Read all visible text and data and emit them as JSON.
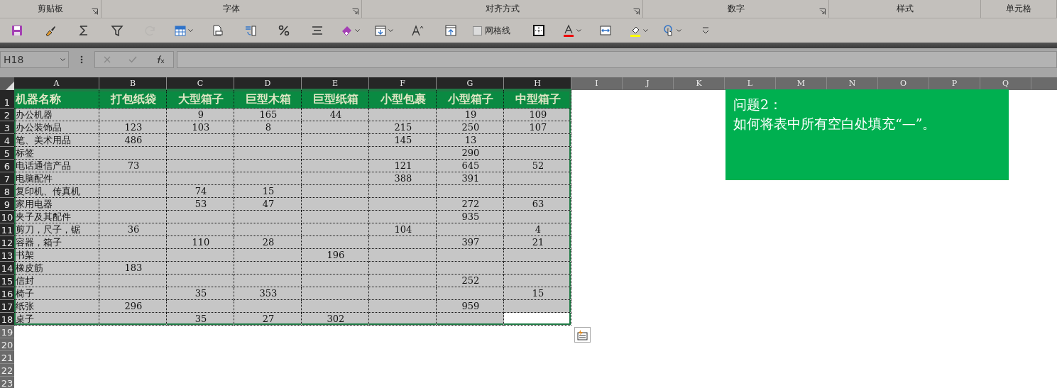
{
  "ribbon_groups": [
    {
      "label": "剪贴板",
      "launcher": true
    },
    {
      "label": "字体",
      "launcher": true
    },
    {
      "label": "对齐方式",
      "launcher": true
    },
    {
      "label": "数字",
      "launcher": true
    },
    {
      "label": "样式",
      "launcher": false
    },
    {
      "label": "单元格",
      "launcher": false
    }
  ],
  "toolbar": [
    {
      "kind": "save",
      "disabled": false,
      "dropdown": false
    },
    {
      "kind": "brush",
      "disabled": false,
      "dropdown": false
    },
    {
      "kind": "sum",
      "disabled": false,
      "dropdown": false
    },
    {
      "kind": "filter",
      "disabled": false,
      "dropdown": false
    },
    {
      "kind": "redo",
      "disabled": true,
      "dropdown": false
    },
    {
      "kind": "table",
      "disabled": false,
      "dropdown": true
    },
    {
      "kind": "print",
      "disabled": false,
      "dropdown": false
    },
    {
      "kind": "convert",
      "disabled": false,
      "dropdown": false
    },
    {
      "kind": "percent",
      "disabled": false,
      "dropdown": false
    },
    {
      "kind": "align",
      "disabled": false,
      "dropdown": false
    },
    {
      "kind": "eraser",
      "disabled": false,
      "dropdown": true
    },
    {
      "kind": "filldown",
      "disabled": false,
      "dropdown": true
    },
    {
      "kind": "fontsize",
      "disabled": false,
      "dropdown": false
    },
    {
      "kind": "upload",
      "disabled": false,
      "dropdown": false
    },
    {
      "kind": "checkbox",
      "label": "网格线",
      "checked": false
    },
    {
      "kind": "borders",
      "disabled": false,
      "dropdown": false
    },
    {
      "kind": "fontcolor",
      "disabled": false,
      "dropdown": true
    },
    {
      "kind": "merge",
      "disabled": false,
      "dropdown": false
    },
    {
      "kind": "fillcolor",
      "disabled": false,
      "dropdown": true
    },
    {
      "kind": "touch",
      "disabled": false,
      "dropdown": true
    },
    {
      "kind": "customize",
      "disabled": false,
      "dropdown": false
    }
  ],
  "name_box": "H18",
  "columns": [
    {
      "label": "A",
      "selected": true
    },
    {
      "label": "B",
      "selected": true
    },
    {
      "label": "C",
      "selected": true
    },
    {
      "label": "D",
      "selected": true
    },
    {
      "label": "E",
      "selected": true
    },
    {
      "label": "F",
      "selected": true
    },
    {
      "label": "G",
      "selected": true
    },
    {
      "label": "H",
      "selected": true
    },
    {
      "label": "I",
      "selected": false
    },
    {
      "label": "J",
      "selected": false
    },
    {
      "label": "K",
      "selected": false
    },
    {
      "label": "L",
      "selected": false
    },
    {
      "label": "M",
      "selected": false
    },
    {
      "label": "N",
      "selected": false
    },
    {
      "label": "O",
      "selected": false
    },
    {
      "label": "P",
      "selected": false
    },
    {
      "label": "Q",
      "selected": false
    }
  ],
  "rows": [
    {
      "number": "1",
      "selected": true,
      "header": true,
      "cells": [
        {
          "text": "机器名称",
          "active": false
        },
        {
          "text": "打包纸袋",
          "active": false
        },
        {
          "text": "大型箱子",
          "active": false
        },
        {
          "text": "巨型木箱",
          "active": false
        },
        {
          "text": "巨型纸箱",
          "active": false
        },
        {
          "text": "小型包裹",
          "active": false
        },
        {
          "text": "小型箱子",
          "active": false
        },
        {
          "text": "中型箱子",
          "active": false
        }
      ]
    },
    {
      "number": "2",
      "selected": true,
      "header": false,
      "cells": [
        {
          "text": "办公机器",
          "active": false
        },
        {
          "active": false
        },
        {
          "text": "9",
          "active": false
        },
        {
          "text": "165",
          "active": false
        },
        {
          "text": "44",
          "active": false
        },
        {
          "active": false
        },
        {
          "text": "19",
          "active": false
        },
        {
          "text": "109",
          "active": false
        }
      ]
    },
    {
      "number": "3",
      "selected": true,
      "header": false,
      "cells": [
        {
          "text": "办公装饰品",
          "active": false
        },
        {
          "text": "123",
          "active": false
        },
        {
          "text": "103",
          "active": false
        },
        {
          "text": "8",
          "active": false
        },
        {
          "active": false
        },
        {
          "text": "215",
          "active": false
        },
        {
          "text": "250",
          "active": false
        },
        {
          "text": "107",
          "active": false
        }
      ]
    },
    {
      "number": "4",
      "selected": true,
      "header": false,
      "cells": [
        {
          "text": "笔、美术用品",
          "active": false
        },
        {
          "text": "486",
          "active": false
        },
        {
          "active": false
        },
        {
          "active": false
        },
        {
          "active": false
        },
        {
          "text": "145",
          "active": false
        },
        {
          "text": "13",
          "active": false
        },
        {
          "active": false
        }
      ]
    },
    {
      "number": "5",
      "selected": true,
      "header": false,
      "cells": [
        {
          "text": "标签",
          "active": false
        },
        {
          "active": false
        },
        {
          "active": false
        },
        {
          "active": false
        },
        {
          "active": false
        },
        {
          "active": false
        },
        {
          "text": "290",
          "active": false
        },
        {
          "active": false
        }
      ]
    },
    {
      "number": "6",
      "selected": true,
      "header": false,
      "cells": [
        {
          "text": "电话通信产品",
          "active": false
        },
        {
          "text": "73",
          "active": false
        },
        {
          "active": false
        },
        {
          "active": false
        },
        {
          "active": false
        },
        {
          "text": "121",
          "active": false
        },
        {
          "text": "645",
          "active": false
        },
        {
          "text": "52",
          "active": false
        }
      ]
    },
    {
      "number": "7",
      "selected": true,
      "header": false,
      "cells": [
        {
          "text": "电脑配件",
          "active": false
        },
        {
          "active": false
        },
        {
          "active": false
        },
        {
          "active": false
        },
        {
          "active": false
        },
        {
          "text": "388",
          "active": false
        },
        {
          "text": "391",
          "active": false
        },
        {
          "active": false
        }
      ]
    },
    {
      "number": "8",
      "selected": true,
      "header": false,
      "cells": [
        {
          "text": "复印机、传真机",
          "active": false
        },
        {
          "active": false
        },
        {
          "text": "74",
          "active": false
        },
        {
          "text": "15",
          "active": false
        },
        {
          "active": false
        },
        {
          "active": false
        },
        {
          "active": false
        },
        {
          "active": false
        }
      ]
    },
    {
      "number": "9",
      "selected": true,
      "header": false,
      "cells": [
        {
          "text": "家用电器",
          "active": false
        },
        {
          "active": false
        },
        {
          "text": "53",
          "active": false
        },
        {
          "text": "47",
          "active": false
        },
        {
          "active": false
        },
        {
          "active": false
        },
        {
          "text": "272",
          "active": false
        },
        {
          "text": "63",
          "active": false
        }
      ]
    },
    {
      "number": "10",
      "selected": true,
      "header": false,
      "cells": [
        {
          "text": "夹子及其配件",
          "active": false
        },
        {
          "active": false
        },
        {
          "active": false
        },
        {
          "active": false
        },
        {
          "active": false
        },
        {
          "active": false
        },
        {
          "text": "935",
          "active": false
        },
        {
          "active": false
        }
      ]
    },
    {
      "number": "11",
      "selected": true,
      "header": false,
      "cells": [
        {
          "text": "剪刀，尺子，锯",
          "active": false
        },
        {
          "text": "36",
          "active": false
        },
        {
          "active": false
        },
        {
          "active": false
        },
        {
          "active": false
        },
        {
          "text": "104",
          "active": false
        },
        {
          "active": false
        },
        {
          "text": "4",
          "active": false
        }
      ]
    },
    {
      "number": "12",
      "selected": true,
      "header": false,
      "cells": [
        {
          "text": "容器，箱子",
          "active": false
        },
        {
          "active": false
        },
        {
          "text": "110",
          "active": false
        },
        {
          "text": "28",
          "active": false
        },
        {
          "active": false
        },
        {
          "active": false
        },
        {
          "text": "397",
          "active": false
        },
        {
          "text": "21",
          "active": false
        }
      ]
    },
    {
      "number": "13",
      "selected": true,
      "header": false,
      "cells": [
        {
          "text": "书架",
          "active": false
        },
        {
          "active": false
        },
        {
          "active": false
        },
        {
          "active": false
        },
        {
          "text": "196",
          "active": false
        },
        {
          "active": false
        },
        {
          "active": false
        },
        {
          "active": false
        }
      ]
    },
    {
      "number": "14",
      "selected": true,
      "header": false,
      "cells": [
        {
          "text": "橡皮筋",
          "active": false
        },
        {
          "text": "183",
          "active": false
        },
        {
          "active": false
        },
        {
          "active": false
        },
        {
          "active": false
        },
        {
          "active": false
        },
        {
          "active": false
        },
        {
          "active": false
        }
      ]
    },
    {
      "number": "15",
      "selected": true,
      "header": false,
      "cells": [
        {
          "text": "信封",
          "active": false
        },
        {
          "active": false
        },
        {
          "active": false
        },
        {
          "active": false
        },
        {
          "active": false
        },
        {
          "active": false
        },
        {
          "text": "252",
          "active": false
        },
        {
          "active": false
        }
      ]
    },
    {
      "number": "16",
      "selected": true,
      "header": false,
      "cells": [
        {
          "text": "椅子",
          "active": false
        },
        {
          "active": false
        },
        {
          "text": "35",
          "active": false
        },
        {
          "text": "353",
          "active": false
        },
        {
          "active": false
        },
        {
          "active": false
        },
        {
          "active": false
        },
        {
          "text": "15",
          "active": false
        }
      ]
    },
    {
      "number": "17",
      "selected": true,
      "header": false,
      "cells": [
        {
          "text": "纸张",
          "active": false
        },
        {
          "text": "296",
          "active": false
        },
        {
          "active": false
        },
        {
          "active": false
        },
        {
          "active": false
        },
        {
          "active": false
        },
        {
          "text": "959",
          "active": false
        },
        {
          "active": false
        }
      ]
    },
    {
      "number": "18",
      "selected": true,
      "header": false,
      "cells": [
        {
          "text": "桌子",
          "active": false
        },
        {
          "active": false
        },
        {
          "text": "35",
          "active": false
        },
        {
          "text": "27",
          "active": false
        },
        {
          "text": "302",
          "active": false
        },
        {
          "active": false
        },
        {
          "active": false
        },
        {
          "active": true
        }
      ]
    },
    {
      "number": "19",
      "selected": false,
      "header": false,
      "cells": []
    },
    {
      "number": "20",
      "selected": false,
      "header": false,
      "cells": []
    },
    {
      "number": "21",
      "selected": false,
      "header": false,
      "cells": []
    },
    {
      "number": "22",
      "selected": false,
      "header": false,
      "cells": []
    },
    {
      "number": "23",
      "selected": false,
      "header": false,
      "cells": []
    }
  ],
  "note": {
    "lines": [
      "问题2：",
      "如何将表中所有空白处填充“—”。"
    ]
  }
}
